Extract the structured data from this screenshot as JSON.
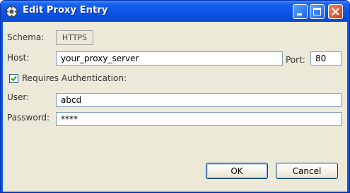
{
  "window": {
    "title": "Edit Proxy Entry"
  },
  "form": {
    "schema_label": "Schema:",
    "schema_value": "HTTPS",
    "host_label": "Host:",
    "host_value": "your_proxy_server",
    "port_label": "Port:",
    "port_value": "80",
    "auth_label": "Requires Authentication:",
    "auth_checked": true,
    "user_label": "User:",
    "user_value": "abcd",
    "password_label": "Password:",
    "password_value": "****"
  },
  "buttons": {
    "ok": "OK",
    "cancel": "Cancel"
  },
  "colors": {
    "titlebar": "#0a55e6",
    "client": "#ece9d8",
    "close": "#d23a15"
  }
}
